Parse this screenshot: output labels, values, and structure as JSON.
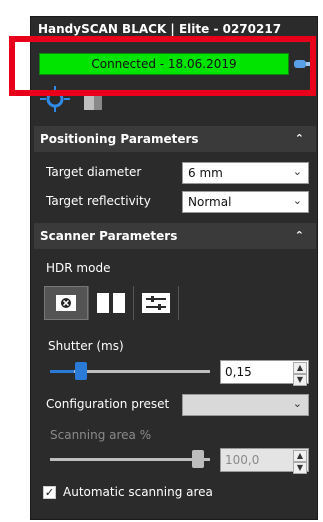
{
  "window": {
    "title": "HandySCAN BLACK | Elite - 0270217"
  },
  "status": {
    "text": "Connected - 18.06.2019",
    "color": "#00e400"
  },
  "positioning": {
    "header": "Positioning Parameters",
    "target_diameter_label": "Target diameter",
    "target_diameter_value": "6 mm",
    "target_reflectivity_label": "Target reflectivity",
    "target_reflectivity_value": "Normal"
  },
  "scanner": {
    "header": "Scanner Parameters",
    "hdr_label": "HDR mode",
    "shutter_label": "Shutter (ms)",
    "shutter_value": "0,15",
    "shutter_level": 0.12,
    "config_label": "Configuration preset",
    "config_value": "",
    "area_label": "Scanning area %",
    "area_value": "100,0",
    "area_level": 1.0,
    "auto_area_label": "Automatic scanning area",
    "auto_area_checked": true
  },
  "icons": {
    "camera": "camera-icon",
    "target": "target-icon",
    "scanner": "scanner-icon",
    "hdr_off": "hdr-off-icon",
    "hdr_half": "hdr-half-icon",
    "hdr_settings": "hdr-settings-icon",
    "collapse": "chevron-up-icon",
    "dropdown": "chevron-down-icon"
  }
}
